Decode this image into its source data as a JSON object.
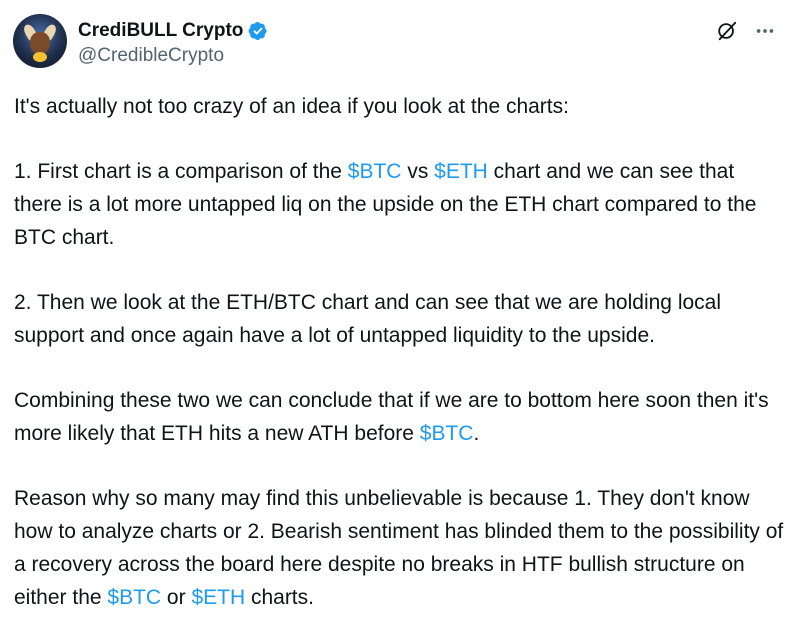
{
  "author": {
    "display_name": "CrediBULL Crypto",
    "handle": "@CredibleCrypto"
  },
  "icons": {
    "verified": "verified-badge-icon",
    "grok": "grok-icon",
    "more": "more-options-icon"
  },
  "colors": {
    "cashtag": "#1d9bf0",
    "verified": "#1d9bf0",
    "text": "#0f1419",
    "handle": "#536471"
  },
  "tweet": {
    "p1": "It's actually not too crazy of an idea if you look at the charts:",
    "p2": {
      "a": "1. First chart is a comparison of the ",
      "tag1": "$BTC",
      "b": " vs ",
      "tag2": "$ETH",
      "c": " chart and we can see that there is a lot more untapped liq on the upside on the ETH chart compared to the BTC chart."
    },
    "p3": "2. Then we look at the ETH/BTC chart and can see that we are holding local support and once again have a lot of untapped liquidity to the upside.",
    "p4": {
      "a": "Combining these two we can conclude that if we are to bottom here soon then it's more likely that ETH hits a new ATH before ",
      "tag1": "$BTC",
      "b": "."
    },
    "p5": {
      "a": "Reason why so many may find this unbelievable is because 1. They don't know how to analyze charts or 2. Bearish sentiment has blinded them to the possibility of a recovery across the board here despite no breaks in HTF bullish structure on either the ",
      "tag1": "$BTC",
      "b": " or ",
      "tag2": "$ETH",
      "c": " charts."
    }
  }
}
